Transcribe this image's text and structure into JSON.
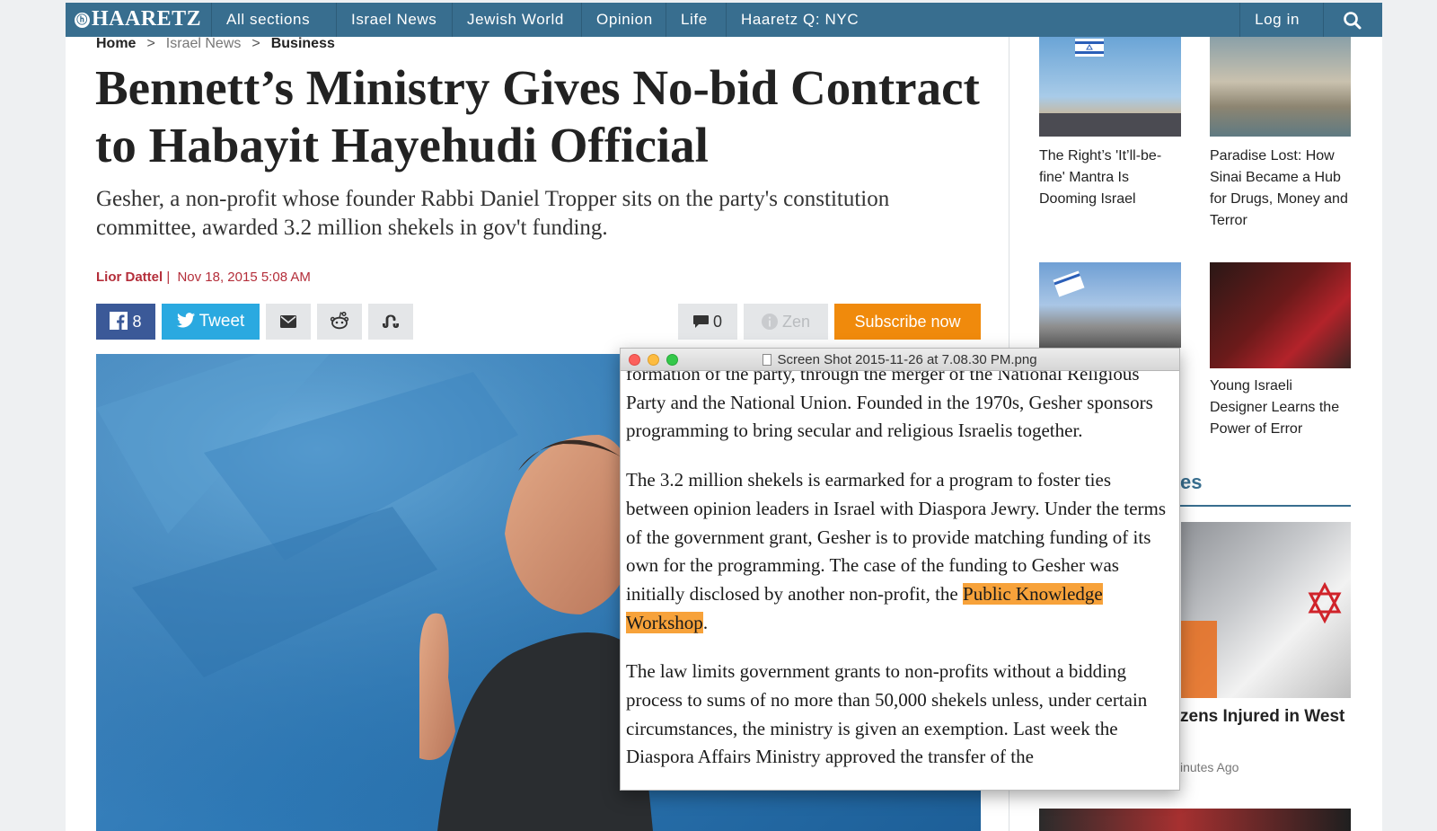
{
  "nav": {
    "logo": "HAARETZ",
    "items": [
      "All sections",
      "Israel News",
      "Jewish World",
      "Opinion",
      "Life",
      "Haaretz Q: NYC"
    ],
    "login": "Log in"
  },
  "breadcrumb": [
    "Home",
    "Israel News",
    "Business"
  ],
  "article": {
    "headline": "Bennett’s Ministry Gives No-bid Contract to Habayit Hayehudi Official",
    "dek": "Gesher, a non-profit whose founder Rabbi Daniel Tropper sits on the party's constitution committee, awarded 3.2 million shekels in gov't funding.",
    "author": "Lior Dattel",
    "date": "Nov 18, 2015 5:08 AM"
  },
  "share": {
    "facebook_count": "8",
    "tweet_label": "Tweet",
    "comment_count": "0",
    "zen_label": "Zen",
    "subscribe_label": "Subscribe now"
  },
  "rail": {
    "story1": "The Right’s 'It’ll-be-fine' Mantra Is Dooming Israel",
    "story2": "Paradise Lost: How Sinai Became a Hub for Drugs, Money and Terror",
    "story3": "Young Israeli Designer Learns the Power of Error",
    "heading_fragment": "es",
    "story4_fragment": "zens Injured in West",
    "time_fragment": "inutes Ago"
  },
  "overlay": {
    "title": "Screen Shot 2015-11-26 at 7.08.30 PM.png",
    "para1": "formation of the party, through the merger of the National Religious Party and the National Union. Founded in the 1970s, Gesher sponsors programming to bring secular and religious Israelis together.",
    "para2_before": "The 3.2 million shekels is earmarked for a program to foster ties between opinion leaders in Israel with Diaspora Jewry. Under the terms of the government grant, Gesher is to provide matching funding of its own for the programming. The case of the funding to Gesher was initially disclosed by another non-profit, the ",
    "para2_highlight": "Public Knowledge Workshop",
    "para2_after": ".",
    "para3": "The law limits government grants to non-profits without a bidding process to sums of no more than 50,000 shekels unless, under certain circumstances, the ministry is given an exemption. Last week the Diaspora Affairs Ministry approved the transfer of the"
  },
  "colors": {
    "nav_bg": "#386e8f",
    "byline": "#b42e3a",
    "facebook": "#3b5998",
    "twitter": "#2aa9e0",
    "subscribe": "#f08a0c",
    "highlight": "#f7a23a"
  }
}
